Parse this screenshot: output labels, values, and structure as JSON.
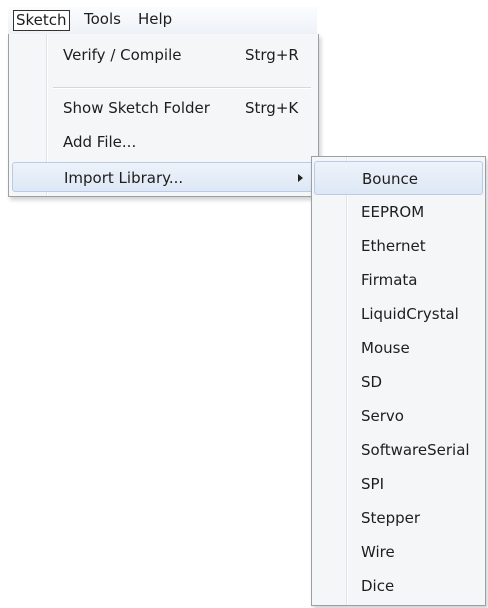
{
  "menubar": {
    "items": [
      {
        "label": "Sketch",
        "state": "open"
      },
      {
        "label": "Tools"
      },
      {
        "label": "Help"
      }
    ]
  },
  "sketch_menu": {
    "items": [
      {
        "label": "Verify / Compile",
        "shortcut": "Strg+R"
      },
      {
        "label": "Show Sketch Folder",
        "shortcut": "Strg+K"
      },
      {
        "label": "Add File..."
      },
      {
        "label": "Import Library...",
        "has_submenu": true,
        "highlighted": true
      }
    ]
  },
  "import_library_submenu": {
    "items": [
      {
        "label": "Bounce",
        "highlighted": true
      },
      {
        "label": "EEPROM"
      },
      {
        "label": "Ethernet"
      },
      {
        "label": "Firmata"
      },
      {
        "label": "LiquidCrystal"
      },
      {
        "label": "Mouse"
      },
      {
        "label": "SD"
      },
      {
        "label": "Servo"
      },
      {
        "label": "SoftwareSerial"
      },
      {
        "label": "SPI"
      },
      {
        "label": "Stepper"
      },
      {
        "label": "Wire"
      },
      {
        "label": "Dice"
      }
    ]
  },
  "colors": {
    "menu_background": "#f5f6f7",
    "highlight": "#dde7f5",
    "highlight_border": "#b9cbe6",
    "border": "#9aa0a8"
  }
}
